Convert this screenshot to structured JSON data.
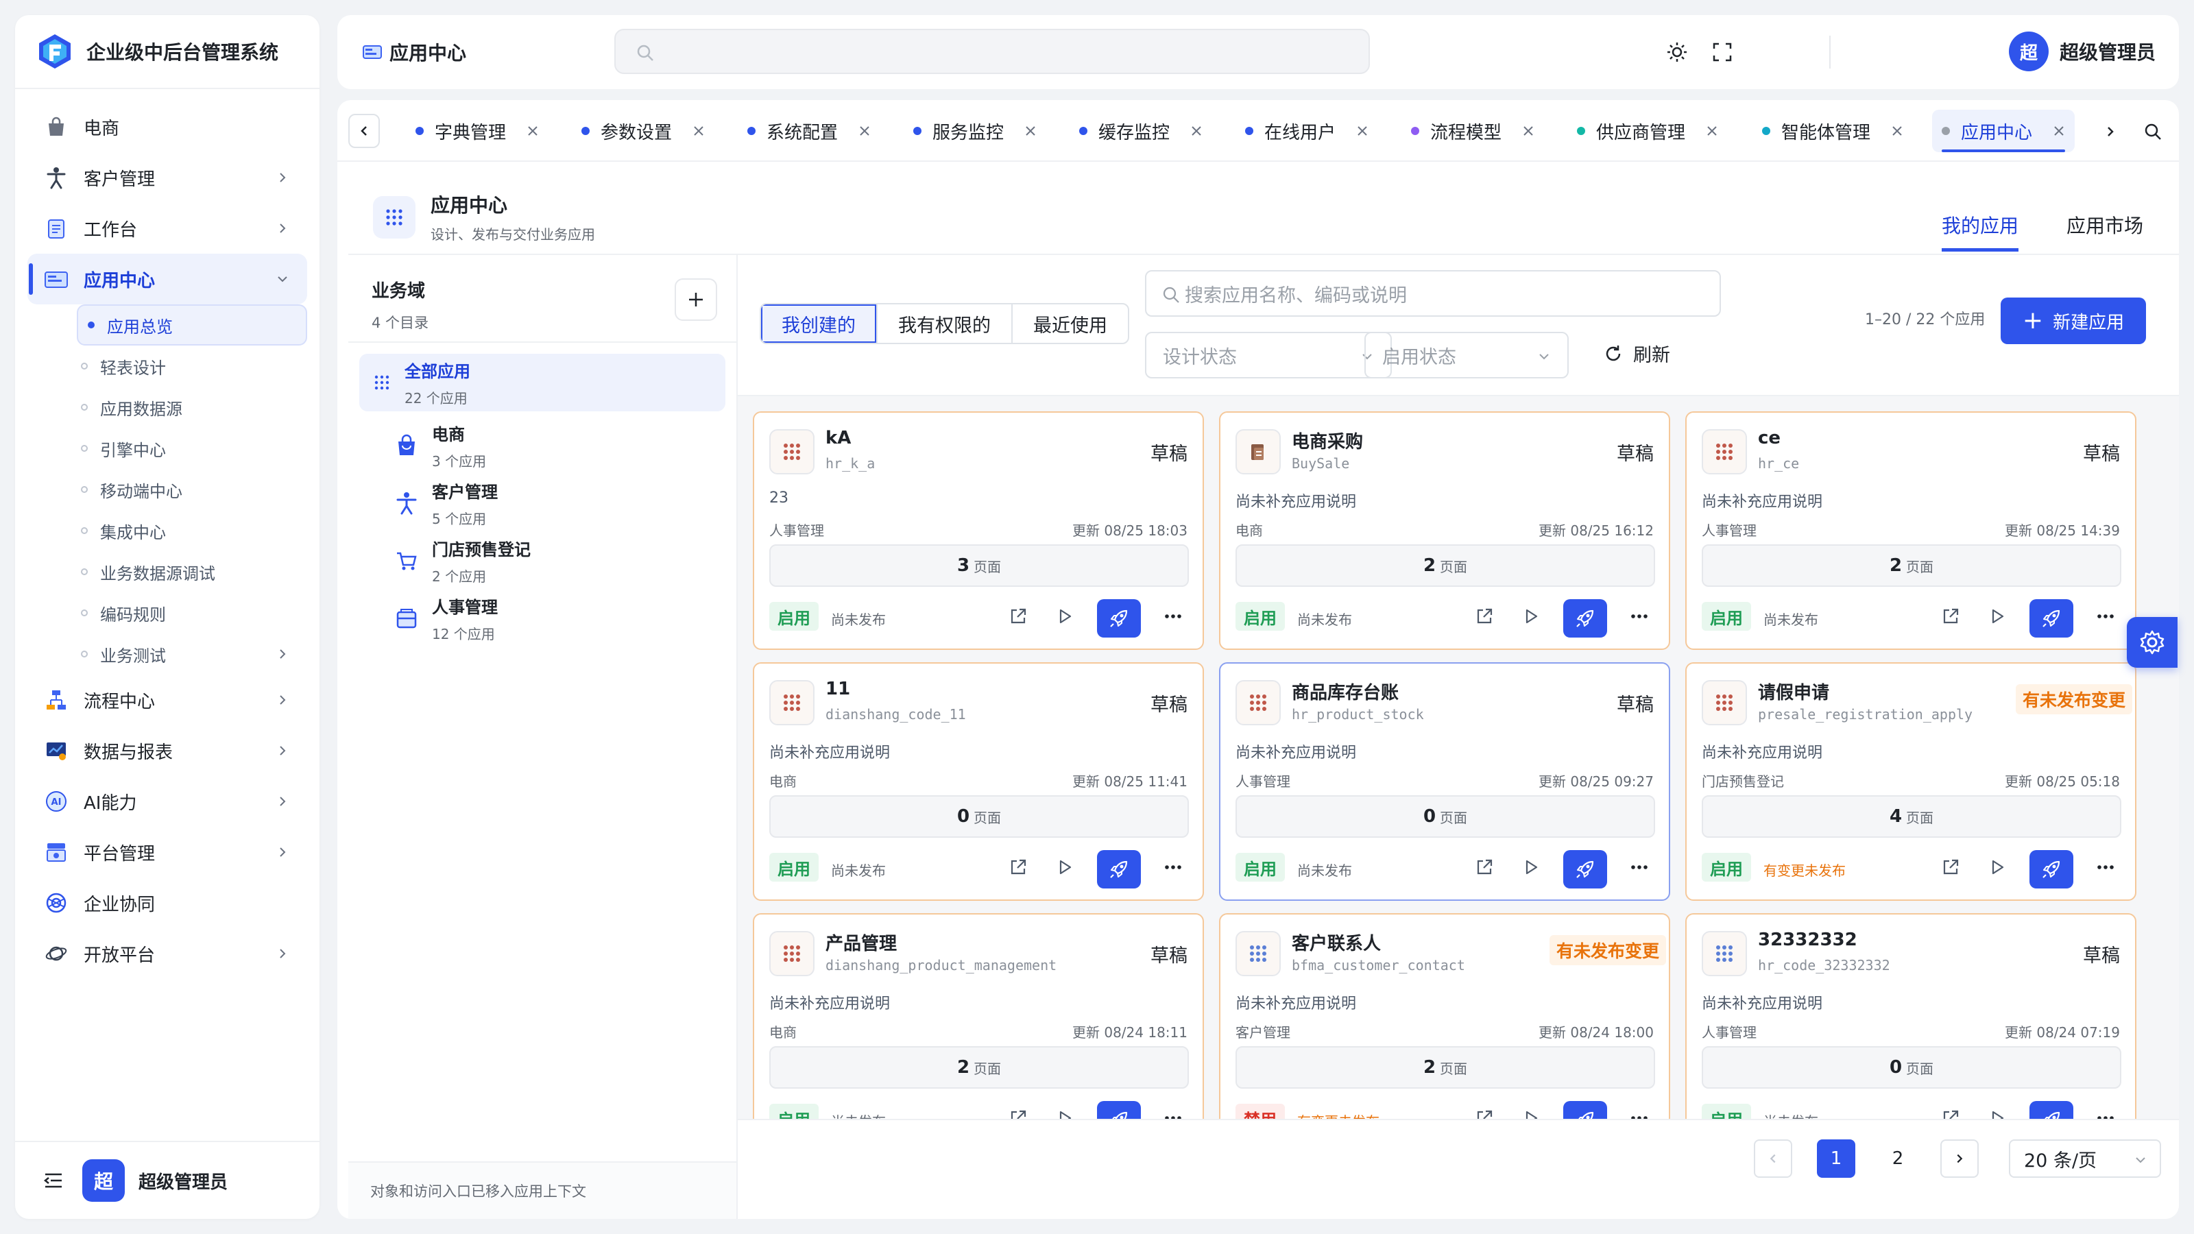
{
  "brand": {
    "name": "企业级中后台管理系统"
  },
  "sidebar": {
    "items": [
      {
        "label": "电商",
        "icon": "shopping-bag-icon"
      },
      {
        "label": "客户管理",
        "icon": "person-icon"
      },
      {
        "label": "工作台",
        "icon": "clipboard-icon"
      },
      {
        "label": "应用中心",
        "icon": "app-card-icon"
      },
      {
        "label": "流程中心",
        "icon": "flow-icon"
      },
      {
        "label": "数据与报表",
        "icon": "chart-icon"
      },
      {
        "label": "AI能力",
        "icon": "ai-icon"
      },
      {
        "label": "平台管理",
        "icon": "platform-icon"
      },
      {
        "label": "企业协同",
        "icon": "collab-icon"
      },
      {
        "label": "开放平台",
        "icon": "planet-icon"
      }
    ],
    "sub": [
      "应用总览",
      "轻表设计",
      "应用数据源",
      "引擎中心",
      "移动端中心",
      "集成中心",
      "业务数据源调试",
      "编码规则",
      "业务测试"
    ],
    "user": {
      "avatar": "超",
      "name": "超级管理员"
    }
  },
  "header": {
    "title": "应用中心",
    "user_avatar": "超",
    "user_name": "超级管理员"
  },
  "tabs": [
    {
      "label": "字典管理",
      "color": "#2f54eb"
    },
    {
      "label": "参数设置",
      "color": "#2f54eb"
    },
    {
      "label": "系统配置",
      "color": "#2f54eb"
    },
    {
      "label": "服务监控",
      "color": "#2f54eb"
    },
    {
      "label": "缓存监控",
      "color": "#2f54eb"
    },
    {
      "label": "在线用户",
      "color": "#2f54eb"
    },
    {
      "label": "流程模型",
      "color": "#8e5cf2"
    },
    {
      "label": "供应商管理",
      "color": "#13b8a6"
    },
    {
      "label": "智能体管理",
      "color": "#13a8c8"
    },
    {
      "label": "应用中心",
      "color": "#9aa0a8"
    }
  ],
  "page": {
    "title": "应用中心",
    "subtitle": "设计、发布与交付业务应用",
    "tab_mine": "我的应用",
    "tab_market": "应用市场"
  },
  "domain": {
    "title": "业务域",
    "subtitle": "4 个目录",
    "all_label": "全部应用",
    "all_count": "22 个应用",
    "items": [
      {
        "label": "电商",
        "count": "3 个应用"
      },
      {
        "label": "客户管理",
        "count": "5 个应用"
      },
      {
        "label": "门店预售登记",
        "count": "2 个应用"
      },
      {
        "label": "人事管理",
        "count": "12 个应用"
      }
    ],
    "footer": "对象和访问入口已移入应用上下文"
  },
  "toolbar": {
    "seg": [
      "我创建的",
      "我有权限的",
      "最近使用"
    ],
    "search_placeholder": "搜索应用名称、编码或说明",
    "design_status": "设计状态",
    "enable_status": "启用状态",
    "refresh": "刷新",
    "count": "1–20 / 22 个应用",
    "new_app": "新建应用"
  },
  "cards": [
    {
      "name": "kA",
      "code": "hr_k_a",
      "status": "草稿",
      "warn": false,
      "desc": "23",
      "domain": "人事管理",
      "updated": "更新 08/25 18:03",
      "pages": "3",
      "enabled": "启用",
      "on": true,
      "publish": "尚未发布",
      "changed": false
    },
    {
      "name": "电商采购",
      "code": "BuySale",
      "status": "草稿",
      "warn": false,
      "desc": "尚未补充应用说明",
      "domain": "电商",
      "updated": "更新 08/25 16:12",
      "pages": "2",
      "enabled": "启用",
      "on": true,
      "publish": "尚未发布",
      "changed": false
    },
    {
      "name": "ce",
      "code": "hr_ce",
      "status": "草稿",
      "warn": false,
      "desc": "尚未补充应用说明",
      "domain": "人事管理",
      "updated": "更新 08/25 14:39",
      "pages": "2",
      "enabled": "启用",
      "on": true,
      "publish": "尚未发布",
      "changed": false
    },
    {
      "name": "11",
      "code": "dianshang_code_11",
      "status": "草稿",
      "warn": false,
      "desc": "尚未补充应用说明",
      "domain": "电商",
      "updated": "更新 08/25 11:41",
      "pages": "0",
      "enabled": "启用",
      "on": true,
      "publish": "尚未发布",
      "changed": false
    },
    {
      "name": "商品库存台账",
      "code": "hr_product_stock",
      "status": "草稿",
      "warn": false,
      "desc": "尚未补充应用说明",
      "domain": "人事管理",
      "updated": "更新 08/25 09:27",
      "pages": "0",
      "enabled": "启用",
      "on": true,
      "publish": "尚未发布",
      "changed": false
    },
    {
      "name": "请假申请",
      "code": "presale_registration_apply",
      "status": "有未发布变更",
      "warn": true,
      "desc": "尚未补充应用说明",
      "domain": "门店预售登记",
      "updated": "更新 08/25 05:18",
      "pages": "4",
      "enabled": "启用",
      "on": true,
      "publish": "有变更未发布",
      "changed": true
    },
    {
      "name": "产品管理",
      "code": "dianshang_product_management",
      "status": "草稿",
      "warn": false,
      "desc": "尚未补充应用说明",
      "domain": "电商",
      "updated": "更新 08/24 18:11",
      "pages": "2",
      "enabled": "启用",
      "on": true,
      "publish": "尚未发布",
      "changed": false
    },
    {
      "name": "客户联系人",
      "code": "bfma_customer_contact",
      "status": "有未发布变更",
      "warn": true,
      "desc": "尚未补充应用说明",
      "domain": "客户管理",
      "updated": "更新 08/24 18:00",
      "pages": "2",
      "enabled": "禁用",
      "on": false,
      "publish": "有变更未发布",
      "changed": true
    },
    {
      "name": "32332332",
      "code": "hr_code_32332332",
      "status": "草稿",
      "warn": false,
      "desc": "尚未补充应用说明",
      "domain": "人事管理",
      "updated": "更新 08/24 07:19",
      "pages": "0",
      "enabled": "启用",
      "on": true,
      "publish": "尚未发布",
      "changed": false
    }
  ],
  "pages_unit": "页面",
  "pager": {
    "pages": [
      "1",
      "2"
    ],
    "current": "1",
    "size": "20 条/页"
  }
}
